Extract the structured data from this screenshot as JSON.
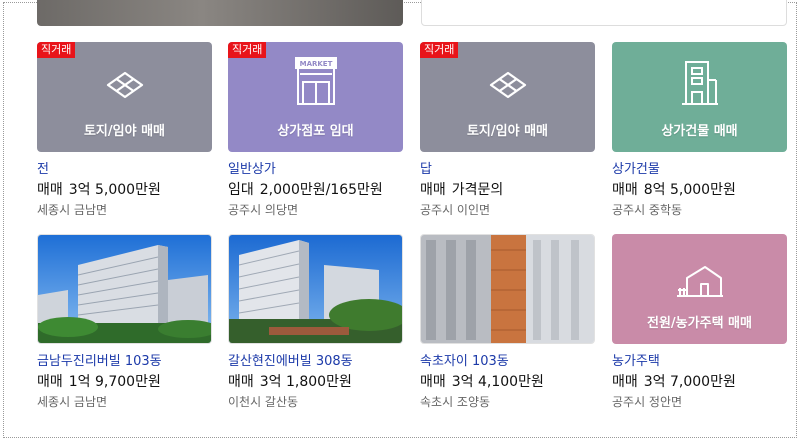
{
  "listings": [
    {
      "badge": "직거래",
      "thumb_label": "토지/임야 매매",
      "thumb_icon": "land-icon",
      "name": "전",
      "deal_type": "매매",
      "price": "3억 5,000만원",
      "location": "세종시 금남면"
    },
    {
      "badge": "직거래",
      "thumb_label": "상가점포 임대",
      "thumb_icon": "market-store-icon",
      "icon_text": "MARKET",
      "name": "일반상가",
      "deal_type": "임대",
      "price": "2,000만원/165만원",
      "location": "공주시 의당면"
    },
    {
      "badge": "직거래",
      "thumb_label": "토지/임야 매매",
      "thumb_icon": "land-icon",
      "name": "답",
      "deal_type": "매매",
      "price": "가격문의",
      "location": "공주시 이인면"
    },
    {
      "thumb_label": "상가건물 매매",
      "thumb_icon": "commercial-building-icon",
      "name": "상가건물",
      "deal_type": "매매",
      "price": "8억 5,000만원",
      "location": "공주시 중학동"
    },
    {
      "thumb_icon": "apartment-photo",
      "name": "금남두진리버빌 103동",
      "deal_type": "매매",
      "price": "1억 9,700만원",
      "location": "세종시 금남면"
    },
    {
      "thumb_icon": "apartment-photo",
      "name": "갈산현진에버빌 308동",
      "deal_type": "매매",
      "price": "3억 1,800만원",
      "location": "이천시 갈산동"
    },
    {
      "thumb_icon": "apartment-photo",
      "name": "속초자이 103동",
      "deal_type": "매매",
      "price": "3억 4,100만원",
      "location": "속초시 조양동"
    },
    {
      "thumb_label": "전원/농가주택 매매",
      "thumb_icon": "farmhouse-icon",
      "name": "농가주택",
      "deal_type": "매매",
      "price": "3억 7,000만원",
      "location": "공주시 정안면"
    }
  ],
  "colors": {
    "badge": "#e8141a",
    "name": "#1c3aa9",
    "gray_thumb": "#8d8e9c",
    "purple_thumb": "#9389c6",
    "green_thumb": "#6fae98",
    "pink_thumb": "#c98ba8"
  }
}
